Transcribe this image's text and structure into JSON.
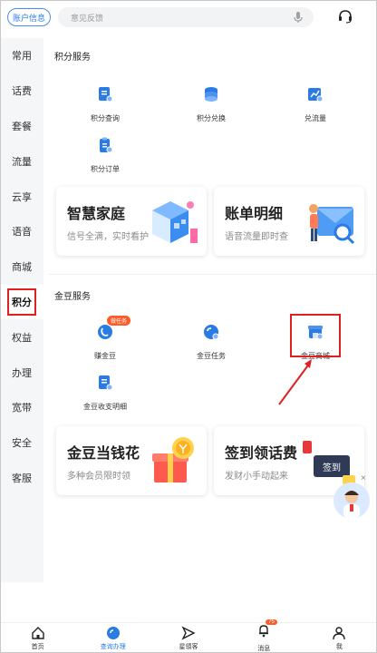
{
  "header": {
    "account_button": "账户信息",
    "search_placeholder": "意见反馈",
    "icons": {
      "mic": "mic-icon",
      "service": "headset-icon"
    }
  },
  "sidebar": {
    "items": [
      {
        "label": "常用"
      },
      {
        "label": "话费"
      },
      {
        "label": "套餐"
      },
      {
        "label": "流量"
      },
      {
        "label": "云享"
      },
      {
        "label": "语音"
      },
      {
        "label": "商城"
      },
      {
        "label": "积分",
        "active": true
      },
      {
        "label": "权益"
      },
      {
        "label": "办理"
      },
      {
        "label": "宽带"
      },
      {
        "label": "安全"
      },
      {
        "label": "客服"
      }
    ]
  },
  "points_section": {
    "title": "积分服务",
    "items": [
      {
        "label": "积分查询",
        "icon": "points-query-icon"
      },
      {
        "label": "积分兑换",
        "icon": "points-exchange-icon"
      },
      {
        "label": "兑流量",
        "icon": "data-exchange-icon"
      },
      {
        "label": "积分订单",
        "icon": "points-order-icon"
      }
    ]
  },
  "promo_cards_1": [
    {
      "title": "智慧家庭",
      "subtitle": "信号全满，实时看护"
    },
    {
      "title": "账单明细",
      "subtitle": "语音流量即时查"
    }
  ],
  "bean_section": {
    "title": "金豆服务",
    "items": [
      {
        "label": "赚金豆",
        "badge": "做任务",
        "icon": "earn-beans-icon"
      },
      {
        "label": "金豆任务",
        "icon": "bean-task-icon"
      },
      {
        "label": "金豆商城",
        "icon": "bean-mall-icon"
      },
      {
        "label": "金豆收支明细",
        "icon": "bean-ledger-icon"
      }
    ]
  },
  "promo_cards_2": [
    {
      "title": "金豆当钱花",
      "subtitle": "多种会员限时领"
    },
    {
      "title": "签到领话费",
      "subtitle": "发财小手动起来",
      "art_text": "签到"
    }
  ],
  "close_glyph": "×",
  "tabbar": {
    "items": [
      {
        "label": "首页"
      },
      {
        "label": "查询办理",
        "active": true
      },
      {
        "label": "星領客"
      },
      {
        "label": "消息",
        "badge": "75"
      },
      {
        "label": "我"
      }
    ]
  },
  "colors": {
    "accent": "#2a7be4",
    "highlight": "#e02020",
    "badge": "#ff5a2a"
  }
}
